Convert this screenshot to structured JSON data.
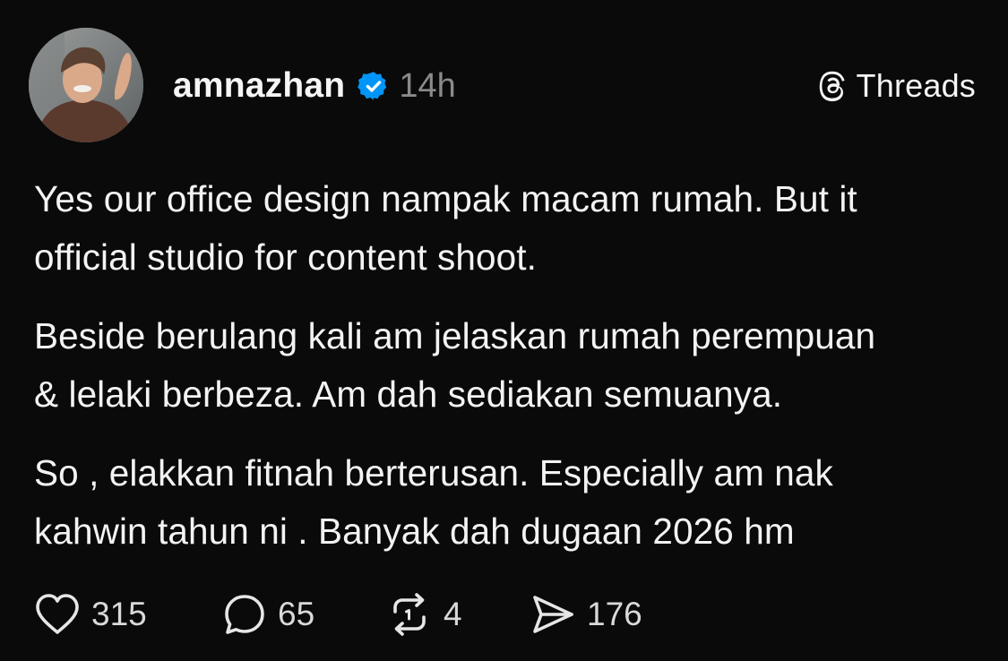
{
  "post": {
    "author": {
      "username": "amnazhan",
      "verified": true,
      "time_ago": "14h"
    },
    "brand": {
      "label": "Threads",
      "icon": "threads-logo-icon"
    },
    "paragraphs": [
      "Yes our office design nampak macam rumah. But it\nofficial studio for content shoot.",
      "Beside berulang kali am jelaskan rumah perempuan\n& lelaki berbeza. Am dah sediakan semuanya.",
      "So , elakkan fitnah berterusan. Especially am nak\nkahwin tahun ni . Banyak dah dugaan 2026 hm"
    ],
    "actions": {
      "likes": "315",
      "replies": "65",
      "reposts": "4",
      "shares": "176"
    }
  },
  "colors": {
    "background": "#0a0a0a",
    "text": "#f3f3f3",
    "muted": "#8a8a8a",
    "verified_blue": "#0095f6"
  }
}
